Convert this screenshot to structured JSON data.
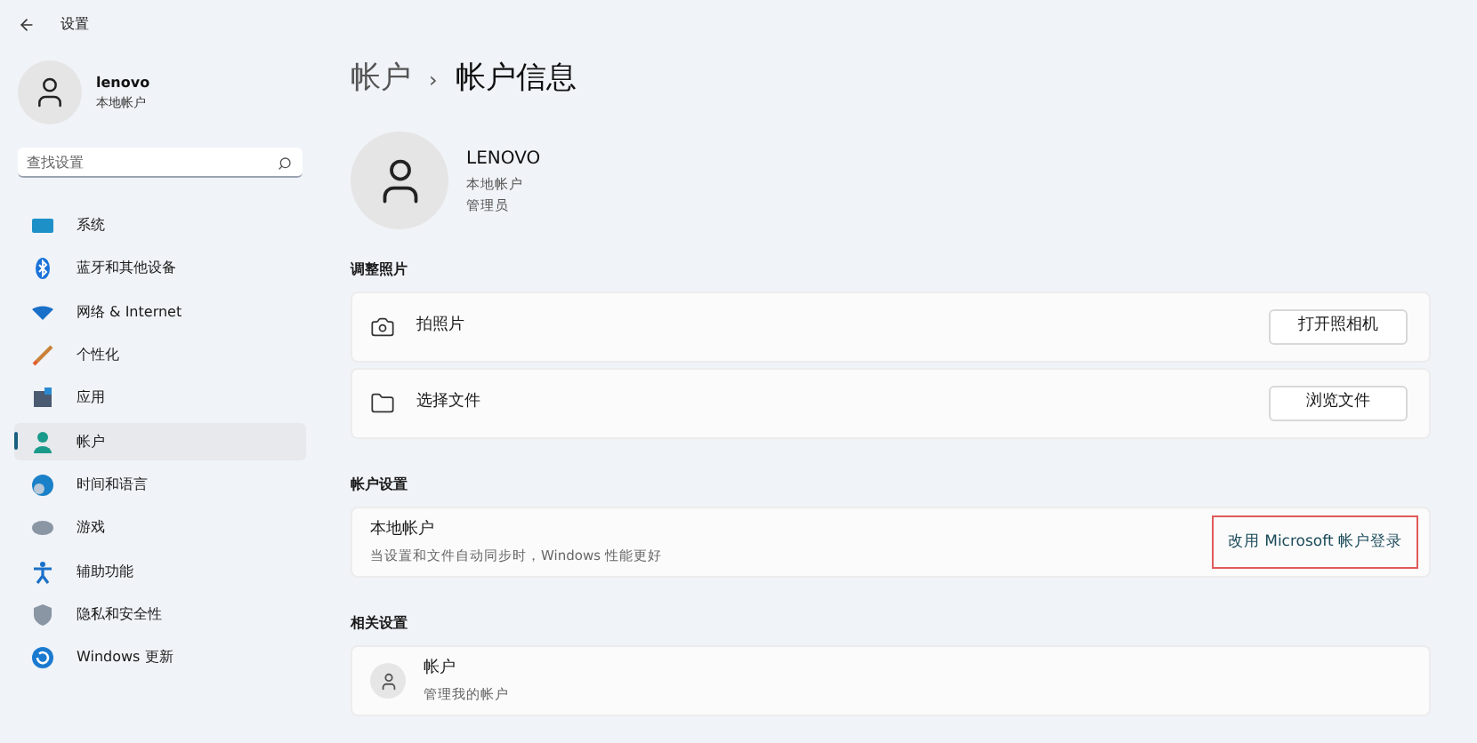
{
  "window": {
    "title": "设置"
  },
  "profile": {
    "name": "lenovo",
    "type": "本地帐户"
  },
  "search": {
    "placeholder": "查找设置"
  },
  "nav": [
    {
      "label": "系统",
      "selected": false
    },
    {
      "label": "蓝牙和其他设备",
      "selected": false
    },
    {
      "label": "网络 & Internet",
      "selected": false
    },
    {
      "label": "个性化",
      "selected": false
    },
    {
      "label": "应用",
      "selected": false
    },
    {
      "label": "帐户",
      "selected": true
    },
    {
      "label": "时间和语言",
      "selected": false
    },
    {
      "label": "游戏",
      "selected": false
    },
    {
      "label": "辅助功能",
      "selected": false
    },
    {
      "label": "隐私和安全性",
      "selected": false
    },
    {
      "label": "Windows 更新",
      "selected": false
    }
  ],
  "breadcrumb": {
    "parent": "帐户",
    "separator": "›",
    "current": "帐户信息"
  },
  "account": {
    "name": "LENOVO",
    "type": "本地帐户",
    "role": "管理员"
  },
  "sections": [
    {
      "title": "调整照片",
      "rows": [
        {
          "kind": "action",
          "label": "拍照片",
          "button": "打开照相机"
        },
        {
          "kind": "action",
          "label": "选择文件",
          "button": "浏览文件"
        }
      ]
    },
    {
      "title": "帐户设置",
      "rows": [
        {
          "kind": "link",
          "label": "本地帐户",
          "description": "当设置和文件自动同步时，Windows 性能更好",
          "link": "改用 Microsoft 帐户登录",
          "highlighted": true
        }
      ]
    },
    {
      "title": "相关设置",
      "rows": [
        {
          "kind": "related",
          "label": "帐户",
          "description": "管理我的帐户"
        }
      ]
    }
  ]
}
